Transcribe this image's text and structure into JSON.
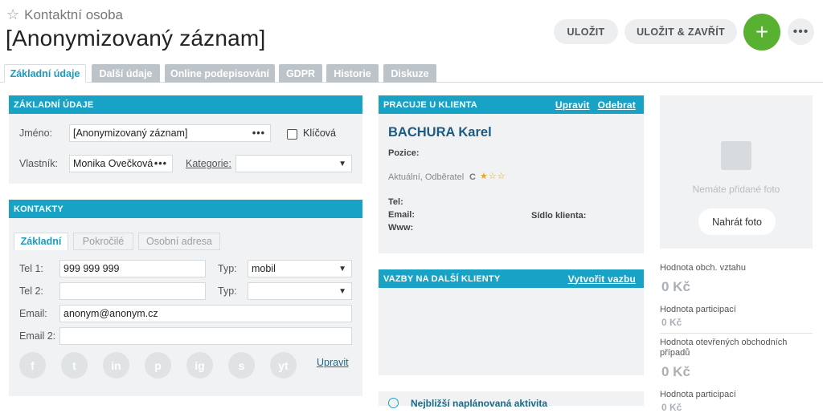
{
  "header": {
    "entity_type": "Kontaktní osoba",
    "record_title": "[Anonymizovaný záznam]",
    "save_label": "ULOŽIT",
    "save_close_label": "ULOŽIT & ZAVŘÍT",
    "add_label": "+",
    "more_label": "•••"
  },
  "tabs": [
    {
      "label": "Základní údaje",
      "active": true
    },
    {
      "label": "Další údaje"
    },
    {
      "label": "Online podepisování"
    },
    {
      "label": "GDPR"
    },
    {
      "label": "Historie"
    },
    {
      "label": "Diskuze"
    }
  ],
  "basic": {
    "heading": "ZÁKLADNÍ ÚDAJE",
    "name_label": "Jméno:",
    "name_value": "[Anonymizovaný záznam]",
    "key_label": "Klíčová",
    "owner_label": "Vlastník:",
    "owner_value": "Monika Ovečková",
    "category_label": "Kategorie:",
    "category_value": ""
  },
  "contacts": {
    "heading": "KONTAKTY",
    "subtabs": [
      "Základní",
      "Pokročilé",
      "Osobní adresa"
    ],
    "tel1_label": "Tel 1:",
    "tel1_value": "999 999 999",
    "type_label": "Typ:",
    "tel1_type": "mobil",
    "tel2_label": "Tel 2:",
    "tel2_value": "",
    "tel2_type": "",
    "email_label": "Email:",
    "email_value": "anonym@anonym.cz",
    "email2_label": "Email 2:",
    "email2_value": "",
    "edit_link": "Upravit",
    "social": [
      "f",
      "t",
      "in",
      "p",
      "ig",
      "s",
      "yt"
    ]
  },
  "client": {
    "heading": "PRACUJE U KLIENTA",
    "edit_link": "Upravit",
    "remove_link": "Odebrat",
    "name": "BACHURA Karel",
    "position_label": "Pozice:",
    "status": "Aktuální, Odběratel",
    "grade": "C",
    "stars": "★☆☆",
    "rating": 1,
    "tel_label": "Tel:",
    "email_label": "Email:",
    "www_label": "Www:",
    "seat_label": "Sídlo klienta:"
  },
  "relations": {
    "heading": "VAZBY NA DALŠÍ KLIENTY",
    "create_link": "Vytvořit vazbu"
  },
  "activity": {
    "label": "Nejbližší naplánovaná aktivita"
  },
  "photo": {
    "no_photo": "Nemáte přidané foto",
    "upload_label": "Nahrát foto"
  },
  "stats": [
    {
      "label": "Hodnota obch. vztahu",
      "value": "0 Kč",
      "big": true
    },
    {
      "label": "Hodnota participací",
      "value": "0 Kč",
      "big": false
    },
    {
      "label": "Hodnota otevřených obchodních případů",
      "value": "0 Kč",
      "big": true
    },
    {
      "label": "Hodnota participací",
      "value": "0 Kč",
      "big": false
    }
  ],
  "colors": {
    "accent": "#18a3c6",
    "add_button": "#58b130",
    "stars": "#e5a823"
  }
}
